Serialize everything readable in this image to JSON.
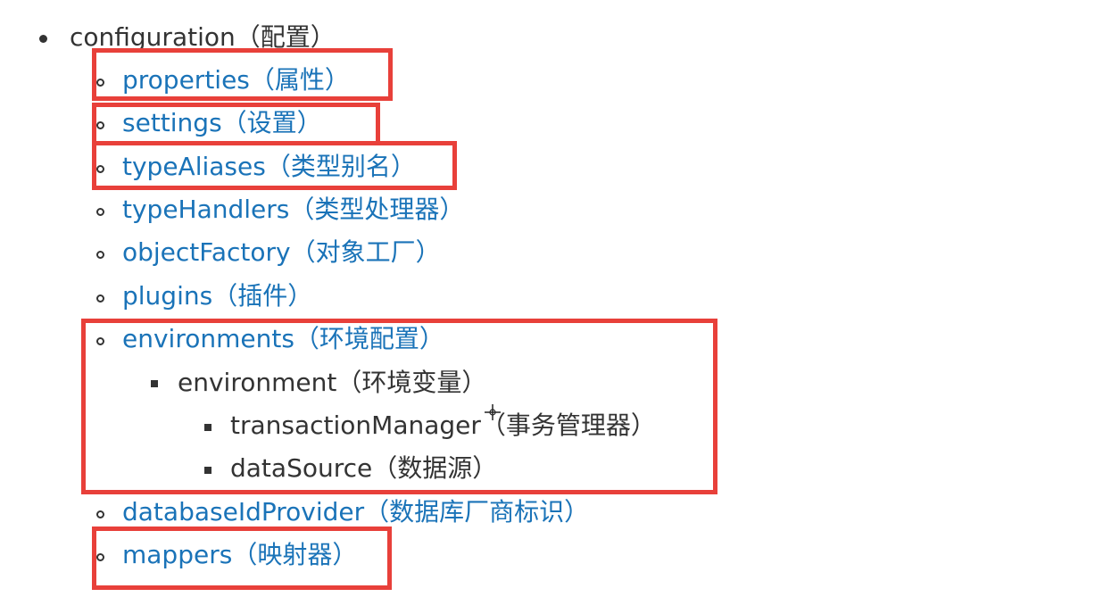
{
  "root": {
    "label": "configuration",
    "zh": "（配置）"
  },
  "items": [
    {
      "label": "properties",
      "zh": "（属性）"
    },
    {
      "label": "settings",
      "zh": "（设置）"
    },
    {
      "label": "typeAliases",
      "zh": "（类型别名）"
    },
    {
      "label": "typeHandlers",
      "zh": "（类型处理器）"
    },
    {
      "label": "objectFactory",
      "zh": "（对象工厂）"
    },
    {
      "label": "plugins",
      "zh": "（插件）"
    },
    {
      "label": "environments",
      "zh": "（环境配置）"
    },
    {
      "label": "databaseIdProvider",
      "zh": "（数据库厂商标识）"
    },
    {
      "label": "mappers",
      "zh": "（映射器）"
    }
  ],
  "environment": {
    "label": "environment",
    "zh": "（环境变量）"
  },
  "environment_children": [
    {
      "label": "transactionManager",
      "zh": "（事务管理器）"
    },
    {
      "label": "dataSource",
      "zh": "（数据源）"
    }
  ],
  "colors": {
    "link": "#1a73b8",
    "text": "#333333",
    "highlight_box": "#e8403a"
  }
}
